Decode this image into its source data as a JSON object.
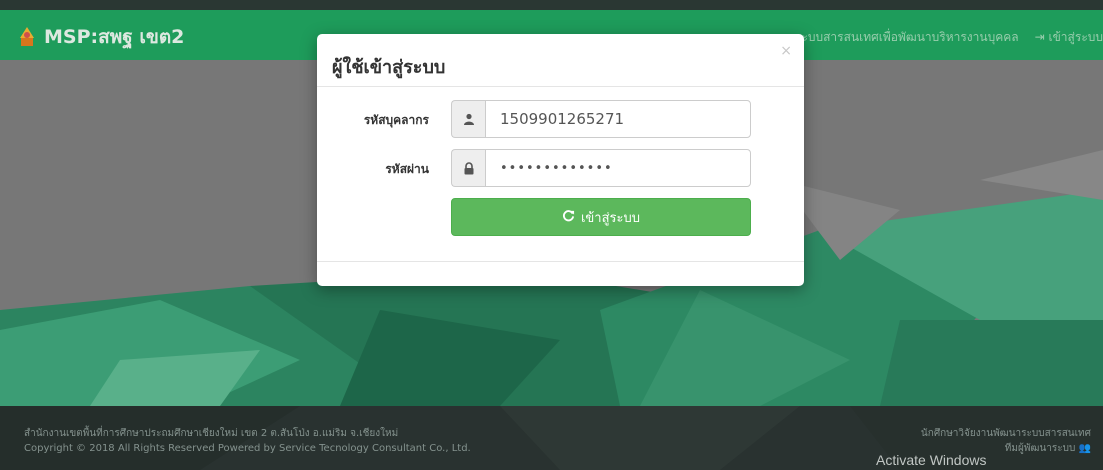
{
  "navbar": {
    "brand": "MSP:สพฐ เขต2",
    "link_info": "ระบบสารสนเทศเพื่อพัฒนาบริหารงานบุคคล",
    "link_login": "เข้าสู่ระบบ"
  },
  "modal": {
    "title": "ผู้ใช้เข้าสู่ระบบ",
    "close": "×",
    "username_label": "รหัสบุคลากร",
    "username_value": "1509901265271",
    "password_label": "รหัสผ่าน",
    "password_value": "•••••••••••••",
    "login_button": "เข้าสู่ระบบ"
  },
  "footer": {
    "left_line1": "สำนักงานเขตพื้นที่การศึกษาประถมศึกษาเชียงใหม่ เขต 2 ต.สันโป่ง อ.แม่ริม จ.เชียงใหม่",
    "left_line2": "Copyright © 2018 All Rights Reserved Powered by Service Tecnology Consultant Co., Ltd.",
    "right_line1": "นักศึกษาวิจัยงานพัฒนาระบบสารสนเทศ",
    "right_line2": "ทีมผู้พัฒนาระบบ"
  },
  "watermark": "Activate Windows",
  "colors": {
    "navbar": "#20a35f",
    "button": "#5cb85c",
    "footer": "#2b3532"
  }
}
